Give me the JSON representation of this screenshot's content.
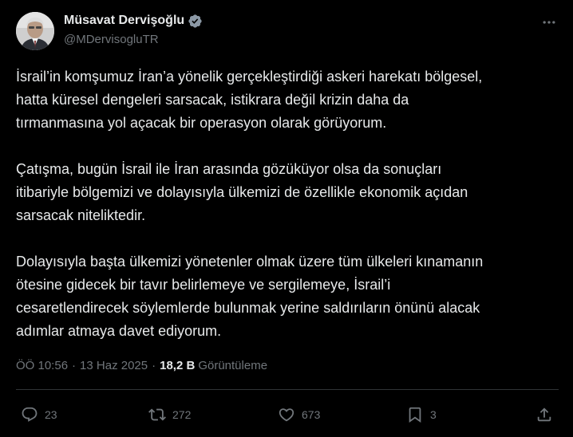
{
  "author": {
    "name": "Müsavat Dervişoğlu",
    "handle": "@MDervisogluTR",
    "avatar_icon": "user-avatar",
    "verified_icon": "verified-badge-icon",
    "verified_color": "#8b98a5"
  },
  "tweet": {
    "paragraphs": [
      "İsrail’in komşumuz İran’a yönelik gerçekleştirdiği askeri harekatı bölgesel,\nhatta küresel dengeleri sarsacak, istikrara değil krizin daha da\ntırmanmasına yol açacak bir operasyon olarak görüyorum.",
      "Çatışma, bugün İsrail ile İran arasında gözüküyor olsa da sonuçları\nitibariyle bölgemizi ve dolayısıyla ülkemizi de özellikle ekonomik açıdan\nsarsacak niteliktedir.",
      "Dolayısıyla başta ülkemizi yönetenler olmak üzere tüm ülkeleri kınamanın\nötesine gidecek bir tavır belirlemeye ve sergilemeye, İsrail’i\ncesaretlendirecek söylemlerde bulunmak yerine saldırıların önünü alacak\nadımlar atmaya davet ediyorum."
    ],
    "time": "ÖÖ 10:56",
    "separator": "·",
    "date": "13 Haz 2025",
    "views_count": "18,2 B",
    "views_label": "Görüntüleme"
  },
  "actions": {
    "replies": "23",
    "reposts": "272",
    "likes": "673",
    "bookmarks": "3"
  },
  "colors": {
    "background": "#000000",
    "text": "#e7e9ea",
    "secondary": "#71767b",
    "divider": "#2f3336"
  }
}
